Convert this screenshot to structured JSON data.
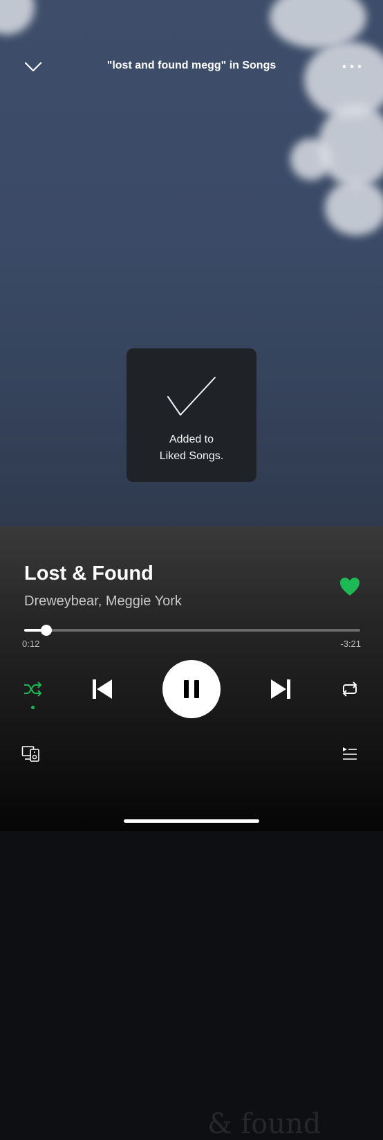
{
  "header": {
    "context_title": "\"lost and found megg\" in Songs"
  },
  "toast": {
    "line1": "Added to",
    "line2": "Liked Songs."
  },
  "track": {
    "title": "Lost & Found",
    "artists": "Dreweybear, Meggie York",
    "liked": true
  },
  "playback": {
    "elapsed": "0:12",
    "remaining": "-3:21",
    "progress_fraction": 0.066,
    "state": "playing",
    "shuffle_on": true
  },
  "icons": {
    "collapse": "chevron-down-icon",
    "more": "more-options-icon",
    "check": "checkmark-icon",
    "heart": "heart-filled-icon",
    "shuffle": "shuffle-icon",
    "prev": "skip-previous-icon",
    "pause": "pause-icon",
    "next": "skip-next-icon",
    "repeat": "repeat-icon",
    "devices": "connect-devices-icon",
    "queue": "queue-icon"
  },
  "colors": {
    "accent": "#1db954",
    "toast_bg": "#1f2125"
  }
}
